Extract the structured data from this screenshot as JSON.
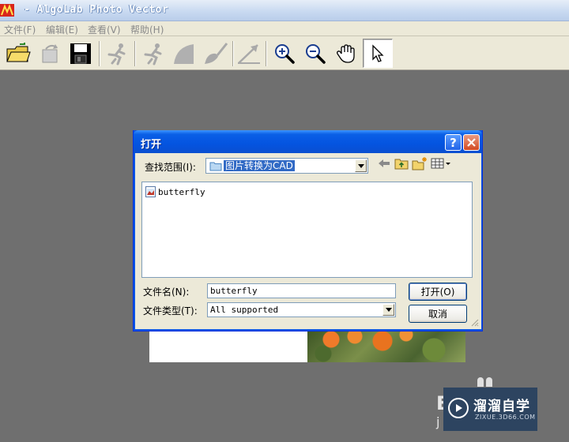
{
  "app": {
    "title": "- AlgoLab Photo Vector"
  },
  "menu": {
    "items": [
      "文件(F)",
      "编辑(E)",
      "查看(V)",
      "帮助(H)"
    ]
  },
  "toolbar": {
    "icons": [
      "open-folder-icon",
      "rotate-icon",
      "save-disk-icon",
      "run-figure-icon",
      "run-figure-icon",
      "fill-shape-icon",
      "brush-icon",
      "resize-arrow-icon",
      "zoom-in-icon",
      "zoom-out-icon",
      "hand-pan-icon",
      "pointer-arrow-icon"
    ],
    "active_tool": "pointer-arrow-icon"
  },
  "dialog": {
    "title": "打开",
    "look_in_label": "查找范围(I):",
    "look_in_value": "图片转换为CAD",
    "files": [
      "butterfly"
    ],
    "filename_label": "文件名(N):",
    "filename_value": "butterfly",
    "filetype_label": "文件类型(T):",
    "filetype_value": "All supported",
    "open_button": "打开(O)",
    "cancel_button": "取消"
  },
  "watermark": {
    "name": "溜溜自学",
    "url": "ZIXUE.3D66.COM"
  },
  "colors": {
    "workspace": "#6f6f6f",
    "dialog_title": "#0454e0",
    "selection": "#316ac5"
  }
}
